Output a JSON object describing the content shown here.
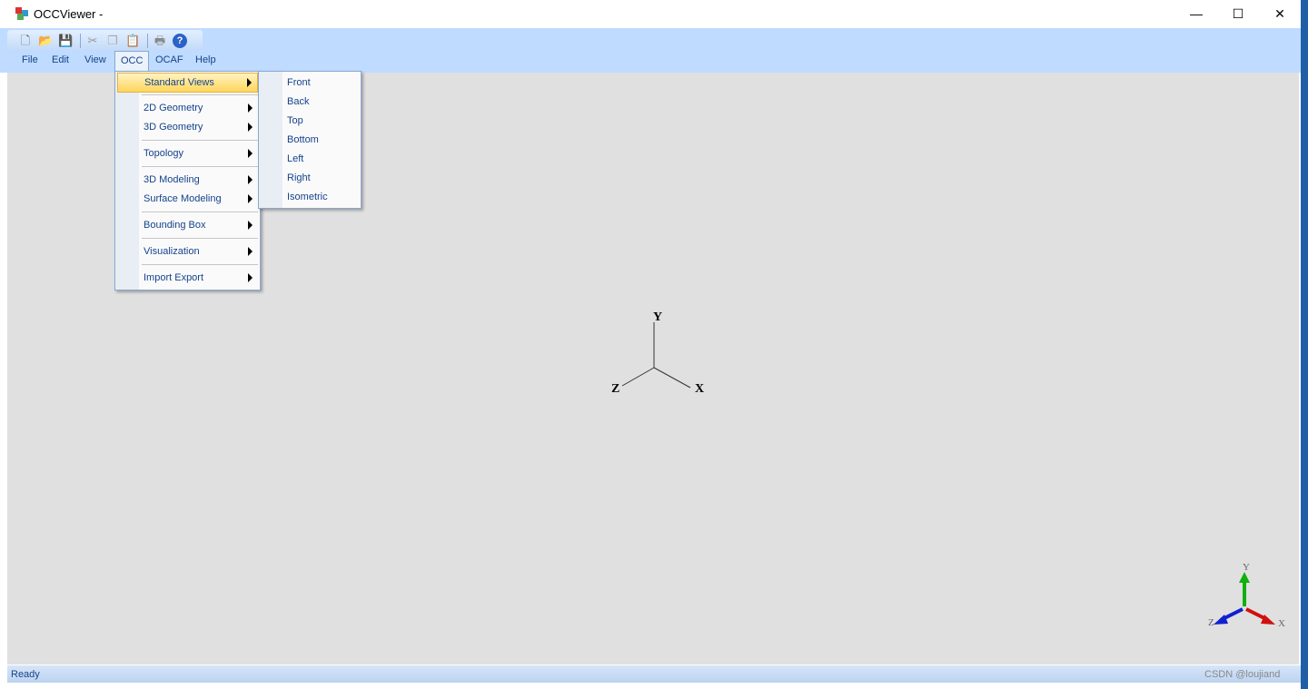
{
  "window": {
    "title": "OCCViewer -",
    "minimize": "—",
    "maximize": "☐",
    "close": "✕"
  },
  "toolbar": {
    "icons": [
      "new-file-icon",
      "open-folder-icon",
      "save-icon",
      "cut-icon",
      "copy-icon",
      "paste-icon",
      "print-icon",
      "help-icon"
    ]
  },
  "menubar": [
    "File",
    "Edit",
    "View",
    "OCC",
    "OCAF",
    "Help"
  ],
  "occ_menu": [
    "Standard Views",
    "2D Geometry",
    "3D Geometry",
    "Topology",
    "3D Modeling",
    "Surface Modeling",
    "Bounding Box",
    "Visualization",
    "Import Export"
  ],
  "standard_views": [
    "Front",
    "Back",
    "Top",
    "Bottom",
    "Left",
    "Right",
    "Isometric"
  ],
  "axes": {
    "x": "X",
    "y": "Y",
    "z": "Z"
  },
  "triedron": {
    "x": "X",
    "y": "Y",
    "z": "Z",
    "colors": {
      "x": "#d01010",
      "y": "#10b010",
      "z": "#1020d0"
    }
  },
  "status": {
    "text": "Ready",
    "watermark": "CSDN @loujiand"
  }
}
